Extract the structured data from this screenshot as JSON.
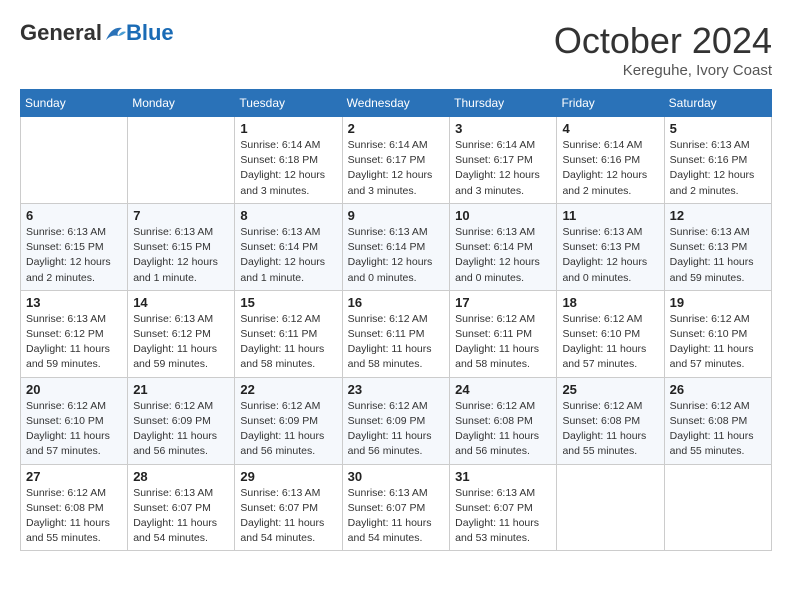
{
  "header": {
    "logo_general": "General",
    "logo_blue": "Blue",
    "month": "October 2024",
    "location": "Kereguhe, Ivory Coast"
  },
  "weekdays": [
    "Sunday",
    "Monday",
    "Tuesday",
    "Wednesday",
    "Thursday",
    "Friday",
    "Saturday"
  ],
  "weeks": [
    [
      {
        "day": "",
        "info": ""
      },
      {
        "day": "",
        "info": ""
      },
      {
        "day": "1",
        "info": "Sunrise: 6:14 AM\nSunset: 6:18 PM\nDaylight: 12 hours and 3 minutes."
      },
      {
        "day": "2",
        "info": "Sunrise: 6:14 AM\nSunset: 6:17 PM\nDaylight: 12 hours and 3 minutes."
      },
      {
        "day": "3",
        "info": "Sunrise: 6:14 AM\nSunset: 6:17 PM\nDaylight: 12 hours and 3 minutes."
      },
      {
        "day": "4",
        "info": "Sunrise: 6:14 AM\nSunset: 6:16 PM\nDaylight: 12 hours and 2 minutes."
      },
      {
        "day": "5",
        "info": "Sunrise: 6:13 AM\nSunset: 6:16 PM\nDaylight: 12 hours and 2 minutes."
      }
    ],
    [
      {
        "day": "6",
        "info": "Sunrise: 6:13 AM\nSunset: 6:15 PM\nDaylight: 12 hours and 2 minutes."
      },
      {
        "day": "7",
        "info": "Sunrise: 6:13 AM\nSunset: 6:15 PM\nDaylight: 12 hours and 1 minute."
      },
      {
        "day": "8",
        "info": "Sunrise: 6:13 AM\nSunset: 6:14 PM\nDaylight: 12 hours and 1 minute."
      },
      {
        "day": "9",
        "info": "Sunrise: 6:13 AM\nSunset: 6:14 PM\nDaylight: 12 hours and 0 minutes."
      },
      {
        "day": "10",
        "info": "Sunrise: 6:13 AM\nSunset: 6:14 PM\nDaylight: 12 hours and 0 minutes."
      },
      {
        "day": "11",
        "info": "Sunrise: 6:13 AM\nSunset: 6:13 PM\nDaylight: 12 hours and 0 minutes."
      },
      {
        "day": "12",
        "info": "Sunrise: 6:13 AM\nSunset: 6:13 PM\nDaylight: 11 hours and 59 minutes."
      }
    ],
    [
      {
        "day": "13",
        "info": "Sunrise: 6:13 AM\nSunset: 6:12 PM\nDaylight: 11 hours and 59 minutes."
      },
      {
        "day": "14",
        "info": "Sunrise: 6:13 AM\nSunset: 6:12 PM\nDaylight: 11 hours and 59 minutes."
      },
      {
        "day": "15",
        "info": "Sunrise: 6:12 AM\nSunset: 6:11 PM\nDaylight: 11 hours and 58 minutes."
      },
      {
        "day": "16",
        "info": "Sunrise: 6:12 AM\nSunset: 6:11 PM\nDaylight: 11 hours and 58 minutes."
      },
      {
        "day": "17",
        "info": "Sunrise: 6:12 AM\nSunset: 6:11 PM\nDaylight: 11 hours and 58 minutes."
      },
      {
        "day": "18",
        "info": "Sunrise: 6:12 AM\nSunset: 6:10 PM\nDaylight: 11 hours and 57 minutes."
      },
      {
        "day": "19",
        "info": "Sunrise: 6:12 AM\nSunset: 6:10 PM\nDaylight: 11 hours and 57 minutes."
      }
    ],
    [
      {
        "day": "20",
        "info": "Sunrise: 6:12 AM\nSunset: 6:10 PM\nDaylight: 11 hours and 57 minutes."
      },
      {
        "day": "21",
        "info": "Sunrise: 6:12 AM\nSunset: 6:09 PM\nDaylight: 11 hours and 56 minutes."
      },
      {
        "day": "22",
        "info": "Sunrise: 6:12 AM\nSunset: 6:09 PM\nDaylight: 11 hours and 56 minutes."
      },
      {
        "day": "23",
        "info": "Sunrise: 6:12 AM\nSunset: 6:09 PM\nDaylight: 11 hours and 56 minutes."
      },
      {
        "day": "24",
        "info": "Sunrise: 6:12 AM\nSunset: 6:08 PM\nDaylight: 11 hours and 56 minutes."
      },
      {
        "day": "25",
        "info": "Sunrise: 6:12 AM\nSunset: 6:08 PM\nDaylight: 11 hours and 55 minutes."
      },
      {
        "day": "26",
        "info": "Sunrise: 6:12 AM\nSunset: 6:08 PM\nDaylight: 11 hours and 55 minutes."
      }
    ],
    [
      {
        "day": "27",
        "info": "Sunrise: 6:12 AM\nSunset: 6:08 PM\nDaylight: 11 hours and 55 minutes."
      },
      {
        "day": "28",
        "info": "Sunrise: 6:13 AM\nSunset: 6:07 PM\nDaylight: 11 hours and 54 minutes."
      },
      {
        "day": "29",
        "info": "Sunrise: 6:13 AM\nSunset: 6:07 PM\nDaylight: 11 hours and 54 minutes."
      },
      {
        "day": "30",
        "info": "Sunrise: 6:13 AM\nSunset: 6:07 PM\nDaylight: 11 hours and 54 minutes."
      },
      {
        "day": "31",
        "info": "Sunrise: 6:13 AM\nSunset: 6:07 PM\nDaylight: 11 hours and 53 minutes."
      },
      {
        "day": "",
        "info": ""
      },
      {
        "day": "",
        "info": ""
      }
    ]
  ]
}
